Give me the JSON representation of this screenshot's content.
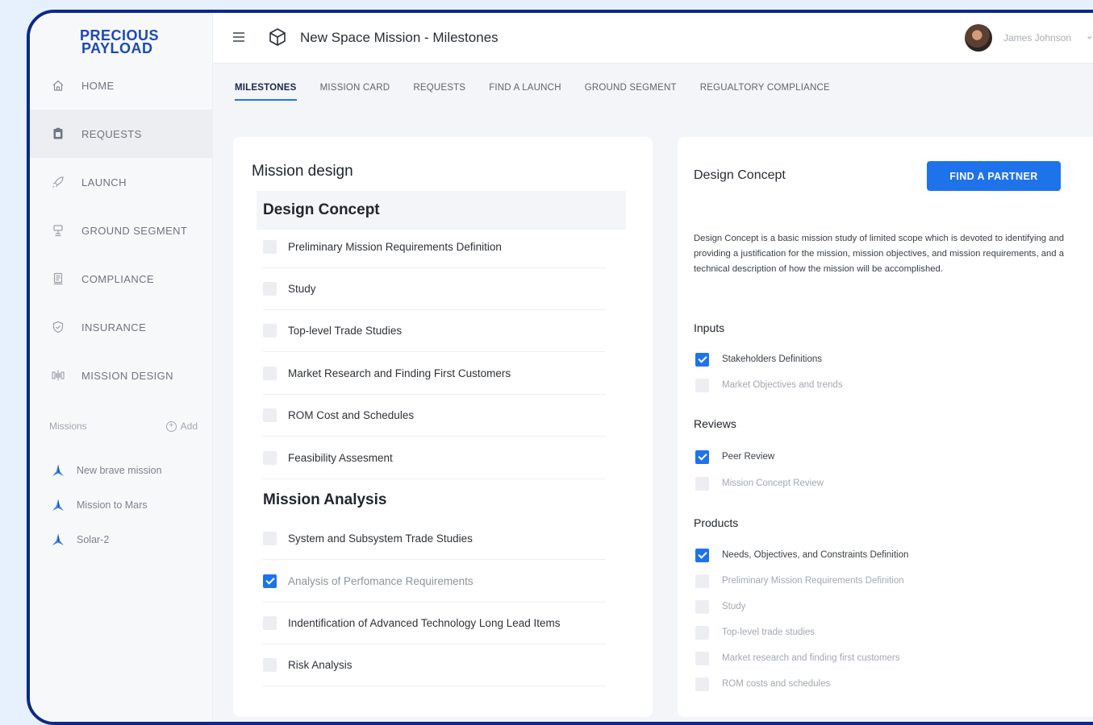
{
  "logo": {
    "line1": "PRECIOUS",
    "line2": "PAYLOAD"
  },
  "sidebar": {
    "items": [
      {
        "label": "HOME",
        "icon": "home-icon"
      },
      {
        "label": "REQUESTS",
        "icon": "requests-icon",
        "active": true
      },
      {
        "label": "LAUNCH",
        "icon": "rocket-icon"
      },
      {
        "label": "GROUND SEGMENT",
        "icon": "antenna-icon"
      },
      {
        "label": "COMPLIANCE",
        "icon": "document-icon"
      },
      {
        "label": "INSURANCE",
        "icon": "shield-icon"
      },
      {
        "label": "MISSION DESIGN",
        "icon": "satellite-icon"
      }
    ],
    "missions_label": "Missions",
    "add_label": "Add",
    "missions": [
      {
        "label": "New brave mission"
      },
      {
        "label": "Mission to Mars"
      },
      {
        "label": "Solar-2"
      }
    ]
  },
  "header": {
    "title": "New Space Mission - Milestones",
    "user_name": "James Johnson"
  },
  "tabs": [
    {
      "label": "MILESTONES",
      "active": true
    },
    {
      "label": "MISSION CARD"
    },
    {
      "label": "REQUESTS"
    },
    {
      "label": "FIND A LAUNCH"
    },
    {
      "label": "GROUND SEGMENT"
    },
    {
      "label": "REGUALTORY COMPLIANCE"
    }
  ],
  "mission_design": {
    "title": "Mission design",
    "groups": [
      {
        "title": "Design Concept",
        "tasks": [
          {
            "label": "Preliminary Mission Requirements Definition",
            "checked": false
          },
          {
            "label": "Study",
            "checked": false
          },
          {
            "label": "Top-level Trade Studies",
            "checked": false
          },
          {
            "label": "Market Research and Finding First Customers",
            "checked": false
          },
          {
            "label": "ROM Cost and Schedules",
            "checked": false
          },
          {
            "label": "Feasibility Assesment",
            "checked": false
          }
        ]
      },
      {
        "title": "Mission Analysis",
        "tasks": [
          {
            "label": "System and Subsystem Trade Studies",
            "checked": false
          },
          {
            "label": "Analysis of Perfomance Requirements",
            "checked": true
          },
          {
            "label": "Indentification of Advanced Technology Long Lead Items",
            "checked": false
          },
          {
            "label": "Risk Analysis",
            "checked": false
          }
        ]
      }
    ]
  },
  "detail": {
    "title": "Design Concept",
    "button": "FIND A PARTNER",
    "description": "Design Concept is a basic mission study of limited scope which is devoted to identifying and providing a justification for the mission, mission objectives, and mission requirements, and a technical description of how the mission will be accomplished.",
    "sections": [
      {
        "title": "Inputs",
        "items": [
          {
            "label": "Stakeholders Definitions",
            "checked": true
          },
          {
            "label": "Market Objectives and trends",
            "checked": false
          }
        ]
      },
      {
        "title": "Reviews",
        "items": [
          {
            "label": "Peer Review",
            "checked": true
          },
          {
            "label": "Mission Concept Review",
            "checked": false
          }
        ]
      },
      {
        "title": "Products",
        "items": [
          {
            "label": "Needs, Objectives, and Constraints Definition",
            "checked": true
          },
          {
            "label": "Preliminary Mission Requirements Definition",
            "checked": false
          },
          {
            "label": "Study",
            "checked": false
          },
          {
            "label": "Top-level trade studies",
            "checked": false
          },
          {
            "label": "Market research and finding first customers",
            "checked": false
          },
          {
            "label": "ROM costs and schedules",
            "checked": false
          }
        ]
      }
    ]
  },
  "colors": {
    "accent": "#1f73ea",
    "frame": "#0b2a88",
    "background": "#e6f1fd"
  }
}
